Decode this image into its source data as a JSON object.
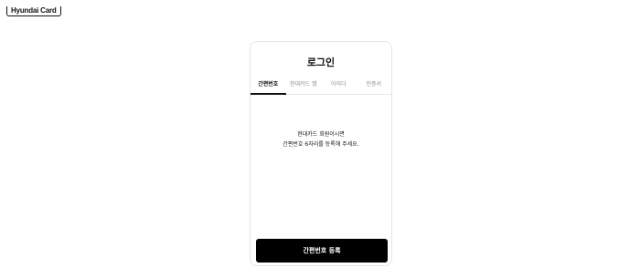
{
  "brand": {
    "logo_text": "Hyundai Card"
  },
  "login": {
    "title": "로그인",
    "tabs": [
      {
        "label": "간편번호",
        "active": true
      },
      {
        "label": "현대카드 앱",
        "active": false
      },
      {
        "label": "아이디",
        "active": false
      },
      {
        "label": "인증서",
        "active": false
      }
    ],
    "message_line1": "현대카드 회원이시면",
    "message_line2": "간편번호 6자리를 등록해 주세요.",
    "register_button_label": "간편번호 등록"
  }
}
